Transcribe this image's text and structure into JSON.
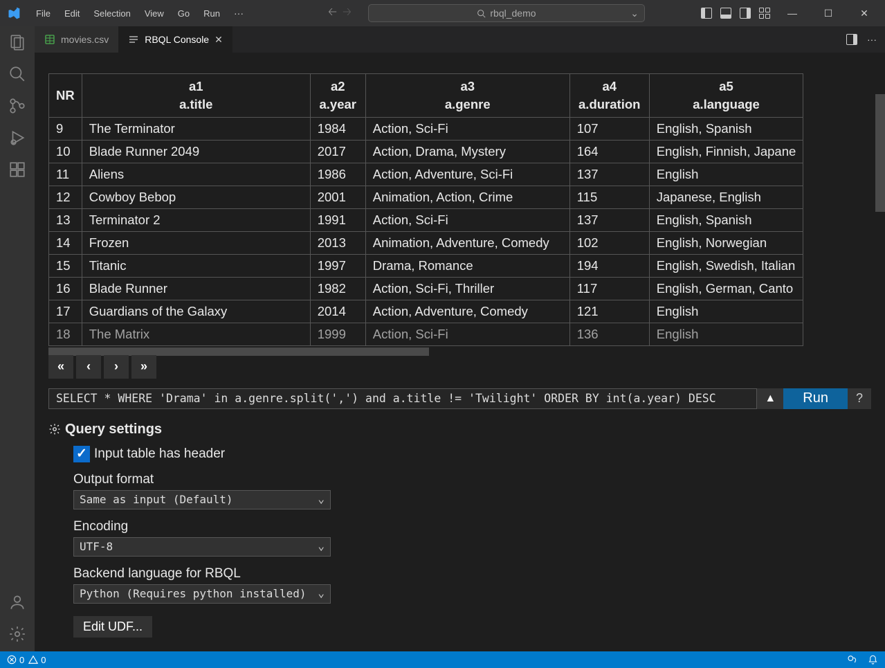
{
  "menu": {
    "file": "File",
    "edit": "Edit",
    "selection": "Selection",
    "view": "View",
    "go": "Go",
    "run": "Run"
  },
  "search_placeholder": "rbql_demo",
  "tabs": {
    "file": "movies.csv",
    "console": "RBQL Console"
  },
  "table": {
    "headers": [
      {
        "code": "NR",
        "name": ""
      },
      {
        "code": "a1",
        "name": "a.title"
      },
      {
        "code": "a2",
        "name": "a.year"
      },
      {
        "code": "a3",
        "name": "a.genre"
      },
      {
        "code": "a4",
        "name": "a.duration"
      },
      {
        "code": "a5",
        "name": "a.language"
      }
    ],
    "rows": [
      {
        "nr": "9",
        "title": "The Terminator",
        "year": "1984",
        "genre": "Action, Sci-Fi",
        "duration": "107",
        "language": "English, Spanish"
      },
      {
        "nr": "10",
        "title": "Blade Runner 2049",
        "year": "2017",
        "genre": "Action, Drama, Mystery",
        "duration": "164",
        "language": "English, Finnish, Japane"
      },
      {
        "nr": "11",
        "title": "Aliens",
        "year": "1986",
        "genre": "Action, Adventure, Sci-Fi",
        "duration": "137",
        "language": "English"
      },
      {
        "nr": "12",
        "title": "Cowboy Bebop",
        "year": "2001",
        "genre": "Animation, Action, Crime",
        "duration": "115",
        "language": "Japanese, English"
      },
      {
        "nr": "13",
        "title": "Terminator 2",
        "year": "1991",
        "genre": "Action, Sci-Fi",
        "duration": "137",
        "language": "English, Spanish"
      },
      {
        "nr": "14",
        "title": "Frozen",
        "year": "2013",
        "genre": "Animation, Adventure, Comedy",
        "duration": "102",
        "language": "English, Norwegian"
      },
      {
        "nr": "15",
        "title": "Titanic",
        "year": "1997",
        "genre": "Drama, Romance",
        "duration": "194",
        "language": "English, Swedish, Italian"
      },
      {
        "nr": "16",
        "title": "Blade Runner",
        "year": "1982",
        "genre": "Action, Sci-Fi, Thriller",
        "duration": "117",
        "language": "English, German, Canto"
      },
      {
        "nr": "17",
        "title": "Guardians of the Galaxy",
        "year": "2014",
        "genre": "Action, Adventure, Comedy",
        "duration": "121",
        "language": "English"
      },
      {
        "nr": "18",
        "title": "The Matrix",
        "year": "1999",
        "genre": "Action, Sci-Fi",
        "duration": "136",
        "language": "English"
      }
    ]
  },
  "query": "SELECT * WHERE 'Drama' in a.genre.split(',') and a.title != 'Twilight' ORDER BY int(a.year) DESC",
  "run_label": "Run",
  "help_label": "?",
  "settings": {
    "title": "Query settings",
    "header_checkbox_label": "Input table has header",
    "output_format_label": "Output format",
    "output_format_value": "Same as input (Default)",
    "encoding_label": "Encoding",
    "encoding_value": "UTF-8",
    "backend_label": "Backend language for RBQL",
    "backend_value": "Python (Requires python installed)",
    "edit_udf": "Edit UDF..."
  },
  "status": {
    "errors": "0",
    "warnings": "0"
  }
}
